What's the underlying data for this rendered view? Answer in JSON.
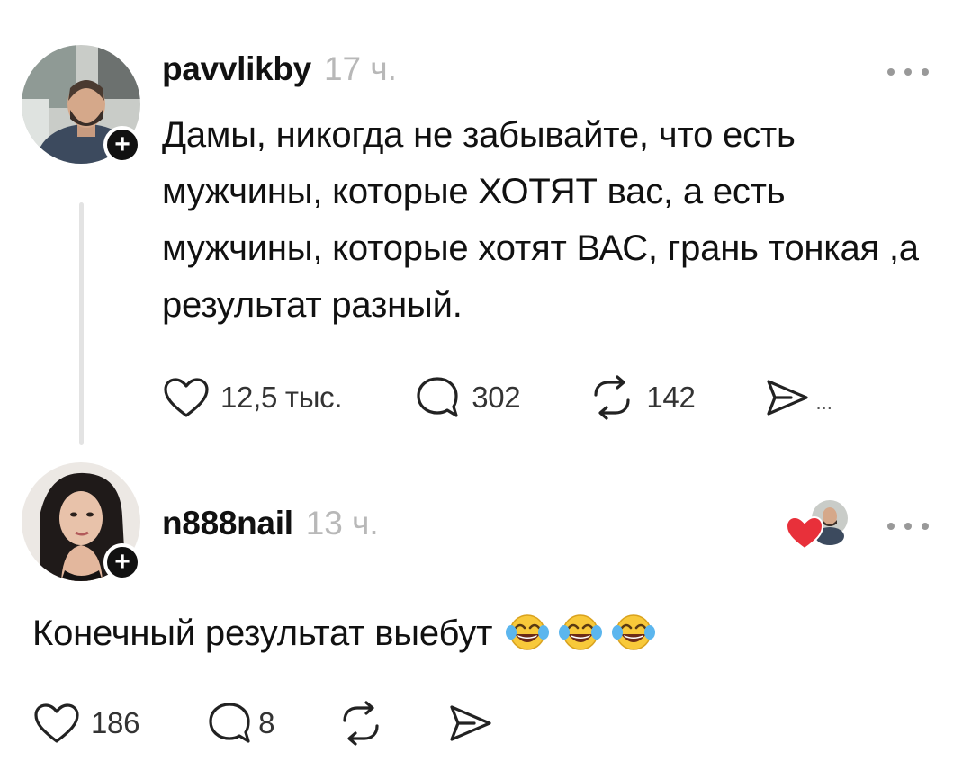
{
  "post1": {
    "username": "pavvlikby",
    "time": "17 ч.",
    "text": "Дамы, никогда не забывайте, что есть мужчины, которые ХОТЯТ вас, а есть мужчины, которые хотят ВАС, грань тонкая ,а результат разный.",
    "likes": "12,5 тыс.",
    "comments": "302",
    "reposts": "142",
    "share_more": "..."
  },
  "post2": {
    "username": "n888nail",
    "time": "13 ч.",
    "text": "Конечный результат выебут",
    "emojis": [
      "face-with-tears-of-joy",
      "face-with-tears-of-joy",
      "face-with-tears-of-joy"
    ],
    "likes": "186",
    "comments": "8"
  },
  "badge_symbol": "+",
  "colors": {
    "text": "#111111",
    "muted": "#b8b8b8",
    "thread_line": "#e3e3e3",
    "heart_red": "#e8303a"
  }
}
